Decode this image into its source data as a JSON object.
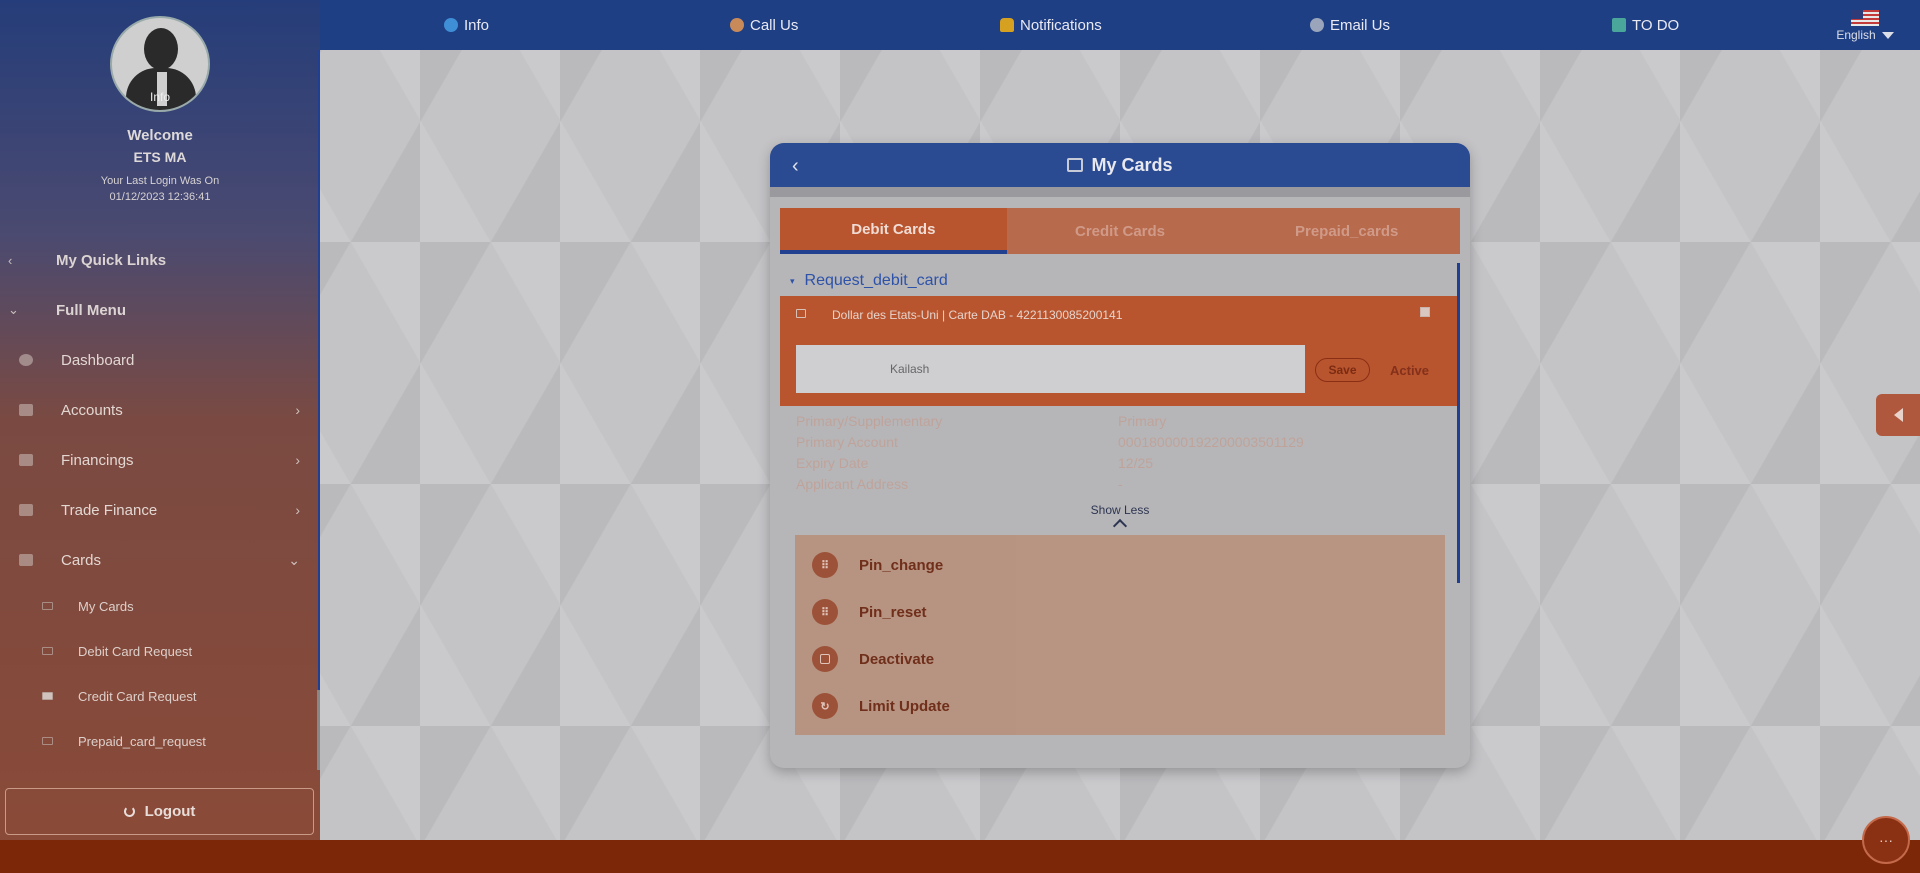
{
  "topnav": {
    "items": [
      {
        "label": "Info",
        "icon": "info-icon"
      },
      {
        "label": "Call Us",
        "icon": "person-icon"
      },
      {
        "label": "Notifications",
        "icon": "bell-icon"
      },
      {
        "label": "Email Us",
        "icon": "email-icon"
      },
      {
        "label": "TO DO",
        "icon": "todo-icon"
      }
    ],
    "language": "English"
  },
  "sidebar": {
    "avatar_caption": "Info",
    "welcome": "Welcome",
    "user": "ETS MA",
    "last_login_label": "Your Last Login Was On",
    "last_login_value": "01/12/2023 12:36:41",
    "quick_links": "My Quick Links",
    "full_menu": "Full Menu",
    "items": [
      {
        "label": "Dashboard"
      },
      {
        "label": "Accounts"
      },
      {
        "label": "Financings"
      },
      {
        "label": "Trade Finance"
      },
      {
        "label": "Cards"
      }
    ],
    "card_sub_items": [
      {
        "label": "My Cards"
      },
      {
        "label": "Debit Card Request"
      },
      {
        "label": "Credit Card Request"
      },
      {
        "label": "Prepaid_card_request"
      }
    ],
    "logout": "Logout"
  },
  "modal": {
    "title": "My Cards",
    "tabs": [
      "Debit Cards",
      "Credit Cards",
      "Prepaid_cards"
    ],
    "request_link": "Request_debit_card",
    "card_title": "Dollar des Etats-Uni | Carte DAB - 4221130085200141",
    "nickname": "Kailash",
    "save": "Save",
    "status": "Active",
    "details": [
      {
        "key": "Primary/Supplementary",
        "value": "Primary"
      },
      {
        "key": "Primary Account",
        "value": "000180000192200003501129"
      },
      {
        "key": "Expiry Date",
        "value": "12/25"
      },
      {
        "key": "Applicant Address",
        "value": "-"
      }
    ],
    "show_less": "Show Less",
    "actions": [
      {
        "label": "Pin_change",
        "icon": "keypad-icon"
      },
      {
        "label": "Pin_reset",
        "icon": "keypad-icon"
      },
      {
        "label": "Deactivate",
        "icon": "square-icon"
      },
      {
        "label": "Limit Update",
        "icon": "refresh-icon"
      }
    ]
  },
  "colors": {
    "brand_blue": "#1f3f85",
    "accent_orange": "#b8552f",
    "bottom_bar": "#7b2708"
  }
}
